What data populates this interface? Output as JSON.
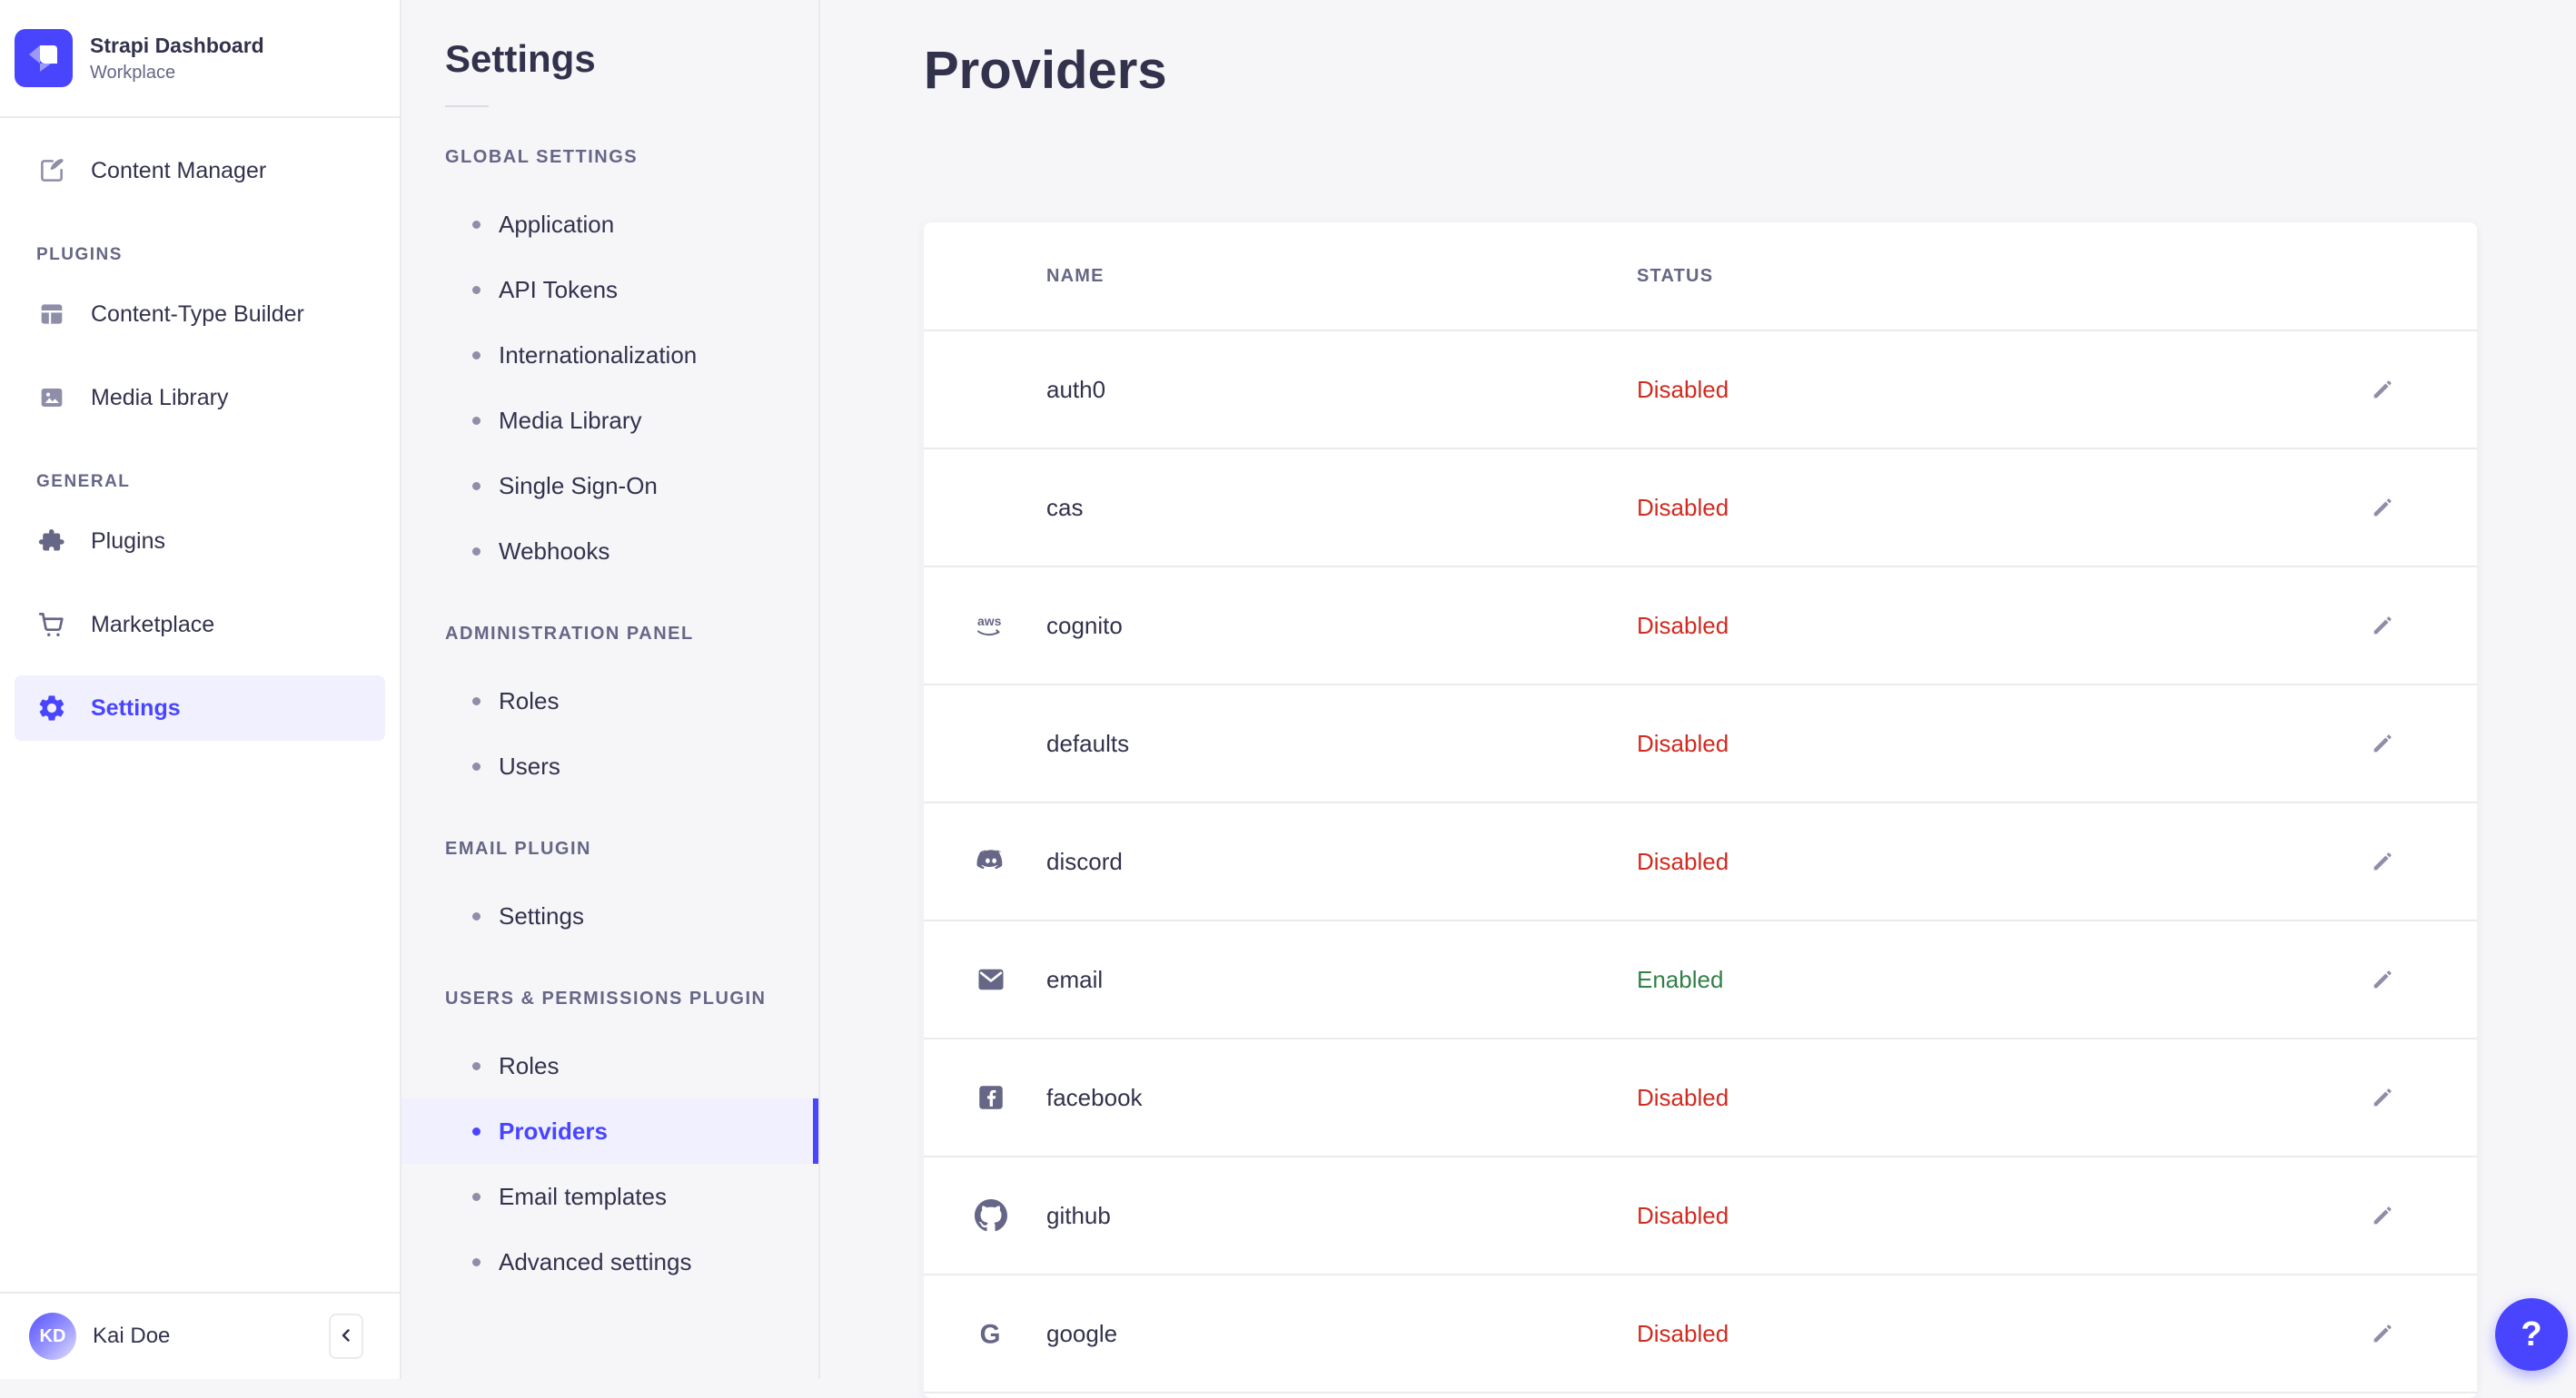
{
  "colors": {
    "primary": "#4945ff",
    "primary_bg": "#f0f0ff",
    "text": "#32324d",
    "muted": "#666687",
    "icon": "#8e8ea9",
    "border": "#eaeaef",
    "bg": "#f6f6f9",
    "card": "#ffffff",
    "danger": "#d02b20",
    "success": "#328048"
  },
  "sidebar": {
    "brand": {
      "title": "Strapi Dashboard",
      "subtitle": "Workplace",
      "logo_icon": "strapi-logo"
    },
    "sections": [
      {
        "label": "PLUGINS"
      },
      {
        "label": "GENERAL"
      }
    ],
    "nav": [
      {
        "label": "Content Manager",
        "icon": "content-manager-icon"
      },
      {
        "label": "Content-Type Builder",
        "icon": "content-type-builder-icon"
      },
      {
        "label": "Media Library",
        "icon": "media-library-icon"
      },
      {
        "label": "Plugins",
        "icon": "plugins-icon"
      },
      {
        "label": "Marketplace",
        "icon": "marketplace-icon"
      },
      {
        "label": "Settings",
        "icon": "settings-gear-icon",
        "active": true
      }
    ],
    "user": {
      "initials": "KD",
      "name": "Kai Doe"
    },
    "collapse_icon": "chevron-left-icon"
  },
  "subnav": {
    "title": "Settings",
    "groups": [
      {
        "label": "GLOBAL SETTINGS",
        "items": [
          {
            "label": "Application"
          },
          {
            "label": "API Tokens"
          },
          {
            "label": "Internationalization"
          },
          {
            "label": "Media Library"
          },
          {
            "label": "Single Sign-On"
          },
          {
            "label": "Webhooks"
          }
        ]
      },
      {
        "label": "ADMINISTRATION PANEL",
        "items": [
          {
            "label": "Roles"
          },
          {
            "label": "Users"
          }
        ]
      },
      {
        "label": "EMAIL PLUGIN",
        "items": [
          {
            "label": "Settings"
          }
        ]
      },
      {
        "label": "USERS & PERMISSIONS PLUGIN",
        "items": [
          {
            "label": "Roles"
          },
          {
            "label": "Providers",
            "active": true
          },
          {
            "label": "Email templates"
          },
          {
            "label": "Advanced settings"
          }
        ]
      }
    ]
  },
  "main": {
    "title": "Providers",
    "table": {
      "headers": [
        "NAME",
        "STATUS"
      ],
      "row_action_icon": "edit-pencil-icon",
      "rows": [
        {
          "name": "auth0",
          "status": "Disabled",
          "icon": null
        },
        {
          "name": "cas",
          "status": "Disabled",
          "icon": null
        },
        {
          "name": "cognito",
          "status": "Disabled",
          "icon": "aws-icon"
        },
        {
          "name": "defaults",
          "status": "Disabled",
          "icon": null
        },
        {
          "name": "discord",
          "status": "Disabled",
          "icon": "discord-icon"
        },
        {
          "name": "email",
          "status": "Enabled",
          "icon": "email-icon"
        },
        {
          "name": "facebook",
          "status": "Disabled",
          "icon": "facebook-icon"
        },
        {
          "name": "github",
          "status": "Disabled",
          "icon": "github-icon"
        },
        {
          "name": "google",
          "status": "Disabled",
          "icon": "google-icon"
        }
      ]
    }
  },
  "help_button": {
    "label": "?"
  }
}
